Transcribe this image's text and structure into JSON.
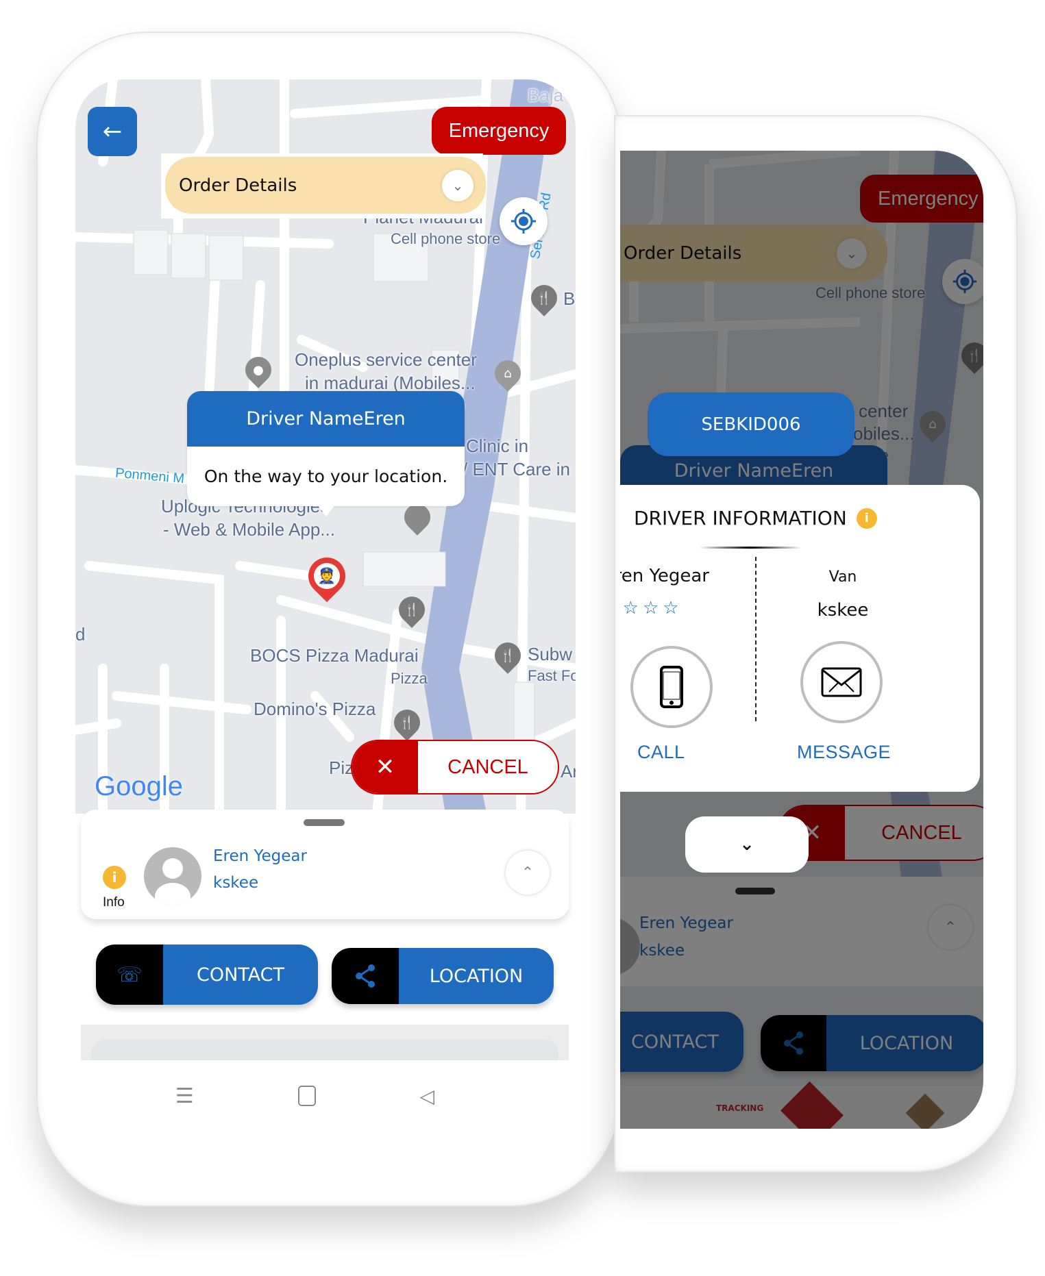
{
  "phone_left": {
    "back_icon": "arrow-left-icon",
    "emergency_label": "Emergency",
    "order_details_label": "Order Details",
    "map": {
      "labels": [
        {
          "text": "Cell phone store",
          "kind": "small"
        },
        {
          "text": "Planet Madurai",
          "kind": "place"
        },
        {
          "text": "Oneplus service center",
          "kind": "place"
        },
        {
          "text": "in madurai (Mobiles...",
          "kind": "place"
        },
        {
          "text": "store",
          "kind": "small"
        },
        {
          "text": "Clinic in",
          "kind": "place"
        },
        {
          "text": "/ ENT Care in",
          "kind": "place"
        },
        {
          "text": "Ponmeni M",
          "kind": "road"
        },
        {
          "text": "Uplogic Technologies",
          "kind": "place"
        },
        {
          "text": "- Web & Mobile App...",
          "kind": "place"
        },
        {
          "text": "BOCS Pizza Madurai",
          "kind": "place"
        },
        {
          "text": "Pizza",
          "kind": "small"
        },
        {
          "text": "Domino's Pizza",
          "kind": "place"
        },
        {
          "text": "Subw",
          "kind": "place"
        },
        {
          "text": "Fast Fo",
          "kind": "small"
        },
        {
          "text": "Piz",
          "kind": "place"
        },
        {
          "text": "Ar",
          "kind": "place"
        },
        {
          "text": "B",
          "kind": "place"
        },
        {
          "text": "d",
          "kind": "place"
        },
        {
          "text": "Baja",
          "kind": "place"
        },
        {
          "text": "Service Rd",
          "kind": "road"
        }
      ],
      "attribution": "Google"
    },
    "driver_bubble": {
      "title": "Driver NameEren",
      "message": "On the way to your location."
    },
    "cancel_label": "CANCEL",
    "sheet": {
      "info_label": "Info",
      "driver_name": "Eren Yegear",
      "vehicle_no": "kskee"
    },
    "contact_label": "CONTACT",
    "location_label": "LOCATION"
  },
  "phone_right": {
    "emergency_label": "Emergency",
    "order_details_label": "Order Details",
    "map_labels": [
      "Cell phone store",
      "center",
      "obiles...",
      "ore"
    ],
    "order_id": "SEBKID006",
    "driver_bubble_title": "Driver NameEren",
    "driver_info": {
      "title": "DRIVER INFORMATION",
      "name": "Eren Yegear",
      "rating": 0,
      "rating_max": 5,
      "vehicle_type": "Van",
      "vehicle_no": "kskee",
      "call_label": "CALL",
      "message_label": "MESSAGE"
    },
    "cancel_label": "CANCEL",
    "sheet": {
      "driver_name": "Eren Yegear",
      "vehicle_no": "kskee"
    },
    "contact_label": "CONTACT",
    "location_label": "LOCATION",
    "banner_text": "TRACKING"
  },
  "colors": {
    "primary_blue": "#1e6bc0",
    "emergency_red": "#c90000",
    "order_bg": "#f9e0ad",
    "info_yellow": "#f7b733"
  }
}
